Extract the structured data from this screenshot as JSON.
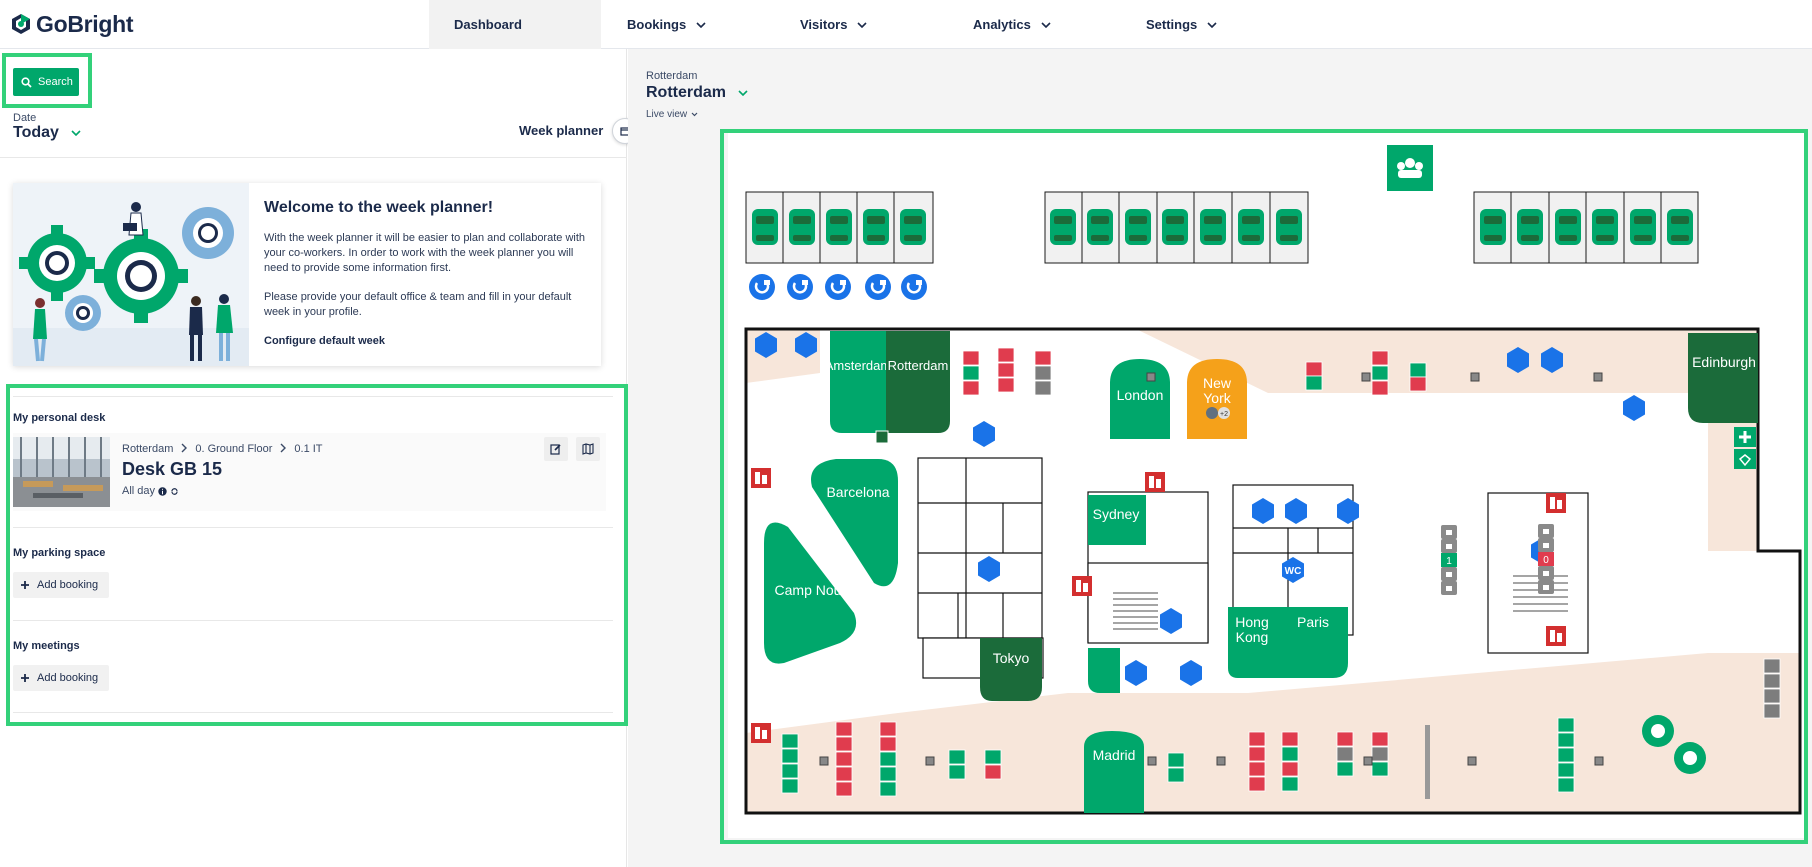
{
  "brand": {
    "name": "GoBright",
    "accent": "#00a76b",
    "dark": "#1b6b3a",
    "navy": "#1b2a4a"
  },
  "nav": [
    {
      "label": "Dashboard",
      "active": true
    },
    {
      "label": "Bookings"
    },
    {
      "label": "Visitors"
    },
    {
      "label": "Analytics"
    },
    {
      "label": "Settings"
    }
  ],
  "left": {
    "search_label": "Search",
    "date_label": "Date",
    "date_value": "Today",
    "week_planner_label": "Week planner",
    "welcome": {
      "title": "Welcome to the week planner!",
      "p1": "With the week planner it will be easier to plan and collaborate with your co-workers. In order to work with the week planner you will need to provide some information first.",
      "p2": "Please provide your default office & team and fill in your default week in your profile.",
      "link": "Configure default week"
    },
    "personal_desk": {
      "title": "My personal desk",
      "crumbs": [
        "Rotterdam",
        "0. Ground Floor",
        "0.1 IT"
      ],
      "name": "Desk GB 15",
      "time": "All day"
    },
    "parking": {
      "title": "My parking space",
      "add_label": "Add booking"
    },
    "meetings": {
      "title": "My meetings",
      "add_label": "Add booking"
    }
  },
  "right": {
    "location_small": "Rotterdam",
    "location_big": "Rotterdam",
    "view_mode": "Live view"
  },
  "map": {
    "rooms": [
      {
        "label": "Amsterdam"
      },
      {
        "label": "Rotterdam"
      },
      {
        "label": "London"
      },
      {
        "label": "New York",
        "line1": "New",
        "line2": "York",
        "badge": "+2"
      },
      {
        "label": "Edinburgh"
      },
      {
        "label": "Barcelona"
      },
      {
        "label": "Camp Nou"
      },
      {
        "label": "Sydney"
      },
      {
        "label": "Tokyo"
      },
      {
        "label": "Hong Kong",
        "line1": "Hong",
        "line2": "Kong"
      },
      {
        "label": "Paris"
      },
      {
        "label": "Madrid"
      }
    ],
    "wc_label": "WC",
    "counter_label": "1",
    "zero_label": "0"
  }
}
